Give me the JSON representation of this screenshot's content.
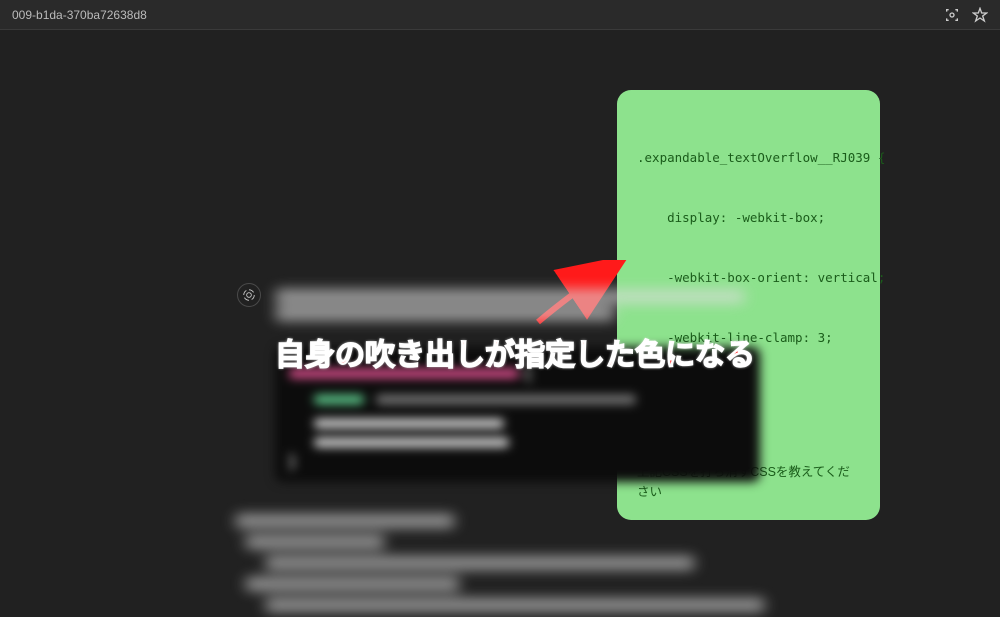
{
  "browser": {
    "url_fragment": "009-b1da-370ba72638d8"
  },
  "user_message": {
    "code_line0": ".expandable_textOverflow__RJ039 {",
    "code_line1": "    display: -webkit-box;",
    "code_line2": "    -webkit-box-orient: vertical;",
    "code_line3": "    -webkit-line-clamp: 3;",
    "code_line4": "}",
    "request": "上記CSSを打ち消すCSSを教えてください"
  },
  "annotation": {
    "text": "自身の吹き出しが指定した色になる",
    "arrow_color": "#ff1a1a"
  },
  "colors": {
    "bubble_bg": "#8de28d",
    "bubble_text": "#1a5c1a",
    "page_bg": "#212121"
  }
}
